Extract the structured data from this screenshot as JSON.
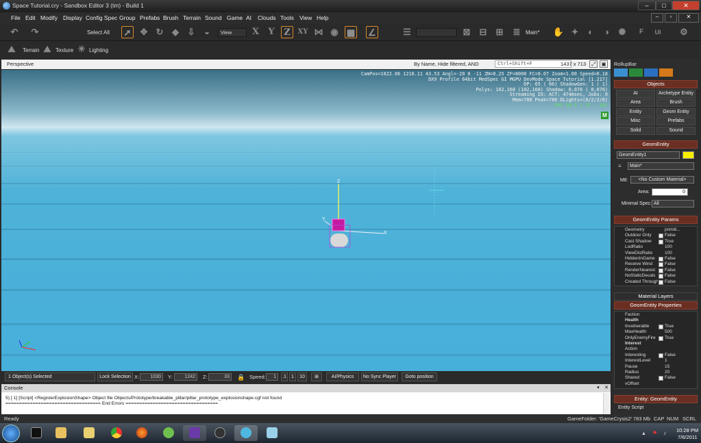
{
  "window": {
    "title": "Space Tutorial.cry - Sandbox Editor 3 (tm) - Build 1"
  },
  "menu": [
    "File",
    "Edit",
    "Modify",
    "Display",
    "Config Spec",
    "Group",
    "Prefabs",
    "Brush",
    "Terrain",
    "Sound",
    "Game",
    "AI",
    "Clouds",
    "Tools",
    "View",
    "Help"
  ],
  "toolbar": {
    "select_all": "Select All",
    "ref_coord": "View",
    "layer": "Main*"
  },
  "toolbar2": {
    "terrain": "Terrain",
    "texture": "Texture",
    "lighting": "Lighting"
  },
  "viewport": {
    "name": "Perspective",
    "filter": "By Name, Hide filtered, AND",
    "search_hint": "Ctrl+Shift+F",
    "resolution": "1437 x 713",
    "stats": [
      "CamPos=1822.06 1218.11 43.53 Angl=-20  0 -11 ZN=0.25 ZF=8000 FC=0.07 Zoom=1.00 Speed=0.18",
      "DX9 Profile 64bit MedSpec GI MGPU DevMode Space Tutorial [1.217]",
      "DP:   65 (  66) ShadowGen:   1 (  1)",
      "Polys: 102,168 (102,168) Shadow: 0,076 ( 0,076)",
      "Streaming IO: ACT: 474msec, Jobs: 0",
      "Mem=788 Peak=786 DLights=(0/2/2/0)"
    ],
    "fps": "FPS  38.5 ( 37.. 39)",
    "mode_badge": "M",
    "gizmo_z": "Z",
    "gizmo_y": "Y",
    "gizmo_x": "X"
  },
  "statusrow": {
    "selected": "1 Object(s) Selected",
    "lock": "Lock Selection",
    "x_label": "X:",
    "x_value": "1030",
    "y_label": "Y:",
    "y_value": "1242",
    "z_label": "Z:",
    "z_value": "33",
    "speed_label": "Speed:",
    "speed_value": "1",
    "speed_opts": [
      ".1",
      "1",
      "10"
    ],
    "ai_physics": "AI/Physics",
    "no_sync": "No Sync Player",
    "goto": "Goto position"
  },
  "console": {
    "title": "Console",
    "line1": "5) [ 1]    [Script]    <RegisterExplosionShape> Object file Objects/Prototype/breakable_pillar/pillar_prototype_explosionshape.cgf not found",
    "line2": "=================================== End Errors =================================="
  },
  "statusbar": {
    "ready": "Ready",
    "folder": "GameFolder: 'GameCrysis2'",
    "mem": "783 Mb",
    "cap": "CAP",
    "num": "NUM",
    "scrl": "SCRL"
  },
  "rollup": {
    "title": "RollupBar",
    "objects_header": "Objects",
    "object_buttons": [
      "AI",
      "Archetype Entity",
      "Area",
      "Brush",
      "Entity",
      "Geom Entity",
      "Misc",
      "Prefabs",
      "Solid",
      "Sound"
    ],
    "geom_header": "GeomEntity",
    "entity_name": "GeomEntity1",
    "color": "#f6f000",
    "layer": "Main*",
    "mtl_label": "Mtl:",
    "mtl_value": "<No Custom Material>",
    "area_label": "Area:",
    "area_value": "0",
    "minspec_label": "Minimal Spec:",
    "minspec_value": "All",
    "params_header": "GeomEntity Params",
    "params": [
      {
        "name": "Geometry",
        "value": "primiti..."
      },
      {
        "name": "Outdoor Only",
        "value": "False"
      },
      {
        "name": "Cast Shadow",
        "value": "True"
      },
      {
        "name": "LodRatio",
        "value": "100"
      },
      {
        "name": "ViewDistRatio",
        "value": "100"
      },
      {
        "name": "HiddenInGame",
        "value": "False"
      },
      {
        "name": "Receive Wind",
        "value": "False"
      },
      {
        "name": "RenderNearest",
        "value": "False"
      },
      {
        "name": "NoStaticDecals",
        "value": "False"
      },
      {
        "name": "Created Through Pool",
        "value": "False"
      }
    ],
    "material_layers": "Material Layers",
    "props_header": "GeomEntity Properties",
    "props": [
      {
        "name": "Faction",
        "value": ""
      },
      {
        "name": "Health",
        "value": ""
      },
      {
        "name": "Invulnerable",
        "value": "True"
      },
      {
        "name": "MaxHealth",
        "value": "500"
      },
      {
        "name": "OnlyEnemyFire",
        "value": "True"
      },
      {
        "name": "Interest",
        "value": ""
      },
      {
        "name": "Action",
        "value": ""
      },
      {
        "name": "Interesting",
        "value": "False"
      },
      {
        "name": "InterestLevel",
        "value": "1"
      },
      {
        "name": "Pause",
        "value": "15"
      },
      {
        "name": "Radius",
        "value": "20"
      },
      {
        "name": "Shared",
        "value": "False"
      },
      {
        "name": "vOffset",
        "value": ""
      }
    ],
    "entity_header": "Entity: GeomEntity",
    "entity_script": "Entity Script"
  },
  "taskbar": {
    "time": "10:28 PM",
    "date": "7/6/2011"
  }
}
